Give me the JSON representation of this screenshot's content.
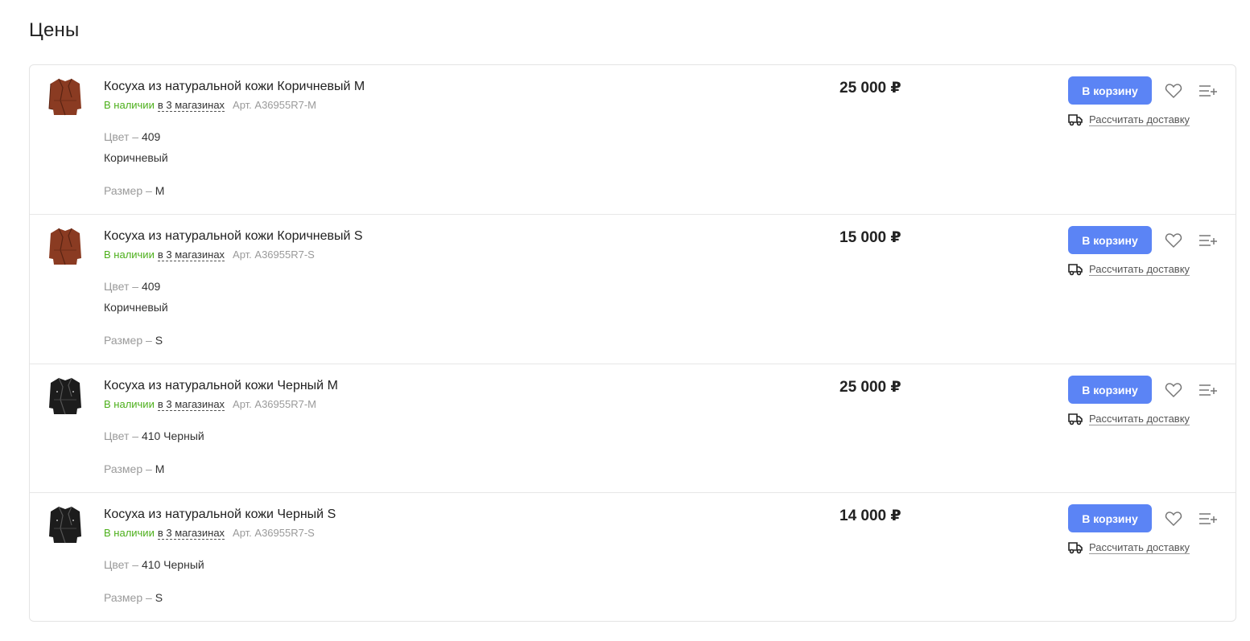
{
  "page": {
    "title": "Цены"
  },
  "colors": {
    "accent": "#5b84f5",
    "in_stock": "#4caf1a",
    "brown_jacket": "#8a3b22",
    "black_jacket": "#1c1c1c"
  },
  "items": [
    {
      "name": "Косуха из натуральной кожи Коричневый M",
      "availability": "В наличии",
      "stores": "в 3 магазинах",
      "sku": "Арт. A36955R7-M",
      "color_label": "Цвет –",
      "color_value": "409",
      "color_extra": "Коричневый",
      "size_label": "Размер –",
      "size_value": "M",
      "price": "25 000 ₽",
      "cart_label": "В корзину",
      "delivery_label": "Рассчитать доставку",
      "image_icon": "brown-jacket-icon"
    },
    {
      "name": "Косуха из натуральной кожи Коричневый S",
      "availability": "В наличии",
      "stores": "в 3 магазинах",
      "sku": "Арт. A36955R7-S",
      "color_label": "Цвет –",
      "color_value": "409",
      "color_extra": "Коричневый",
      "size_label": "Размер –",
      "size_value": "S",
      "price": "15 000 ₽",
      "cart_label": "В корзину",
      "delivery_label": "Рассчитать доставку",
      "image_icon": "brown-jacket-icon"
    },
    {
      "name": "Косуха из натуральной кожи Черный M",
      "availability": "В наличии",
      "stores": "в 3 магазинах",
      "sku": "Арт. A36955R7-M",
      "color_label": "Цвет –",
      "color_value": "410 Черный",
      "size_label": "Размер –",
      "size_value": "M",
      "price": "25 000 ₽",
      "cart_label": "В корзину",
      "delivery_label": "Рассчитать доставку",
      "image_icon": "black-jacket-icon"
    },
    {
      "name": "Косуха из натуральной кожи Черный S",
      "availability": "В наличии",
      "stores": "в 3 магазинах",
      "sku": "Арт. A36955R7-S",
      "color_label": "Цвет –",
      "color_value": "410 Черный",
      "size_label": "Размер –",
      "size_value": "S",
      "price": "14 000 ₽",
      "cart_label": "В корзину",
      "delivery_label": "Рассчитать доставку",
      "image_icon": "black-jacket-icon"
    }
  ]
}
